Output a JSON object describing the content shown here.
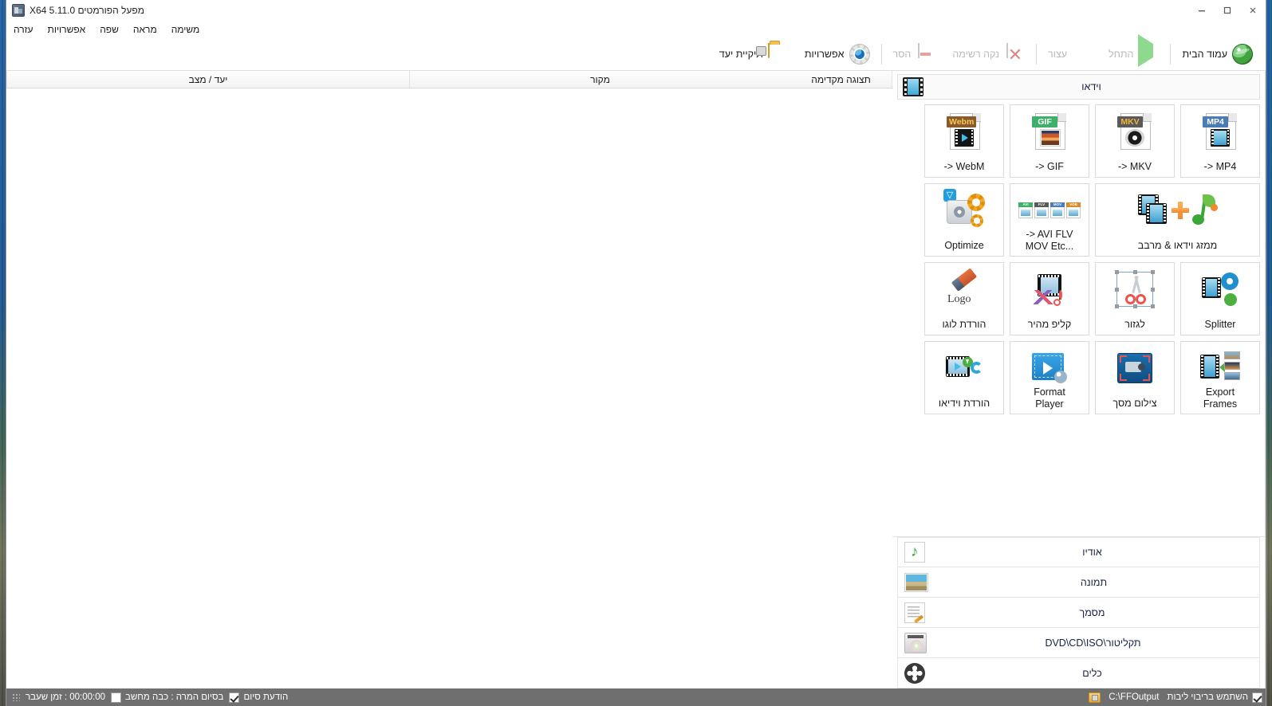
{
  "window": {
    "title": "מפעל הפורמטים X64 5.11.0",
    "app_icon": "app-icon",
    "minimize": "–",
    "maximize": "▢",
    "close": "✕"
  },
  "menu": {
    "items": [
      {
        "label": "משימה",
        "name": "menu-task"
      },
      {
        "label": "מראה",
        "name": "menu-appearance"
      },
      {
        "label": "שפה",
        "name": "menu-language"
      },
      {
        "label": "אפשרויות",
        "name": "menu-options"
      },
      {
        "label": "עזרה",
        "name": "menu-help"
      }
    ]
  },
  "toolbar": {
    "buttons": [
      {
        "label": "עמוד הבית",
        "icon": "globe-icon",
        "disabled": false
      },
      {
        "label": "התחל",
        "icon": "play-icon",
        "disabled": true
      },
      {
        "label": "עצור",
        "icon": "stop-icon",
        "disabled": true
      },
      {
        "label": "נקה רשימה",
        "icon": "clear-list-icon",
        "disabled": true
      },
      {
        "label": "הסר",
        "icon": "remove-icon",
        "disabled": true
      },
      {
        "label": "אפשרויות",
        "icon": "gear-icon",
        "disabled": false
      },
      {
        "label": "תיקיית יעד",
        "icon": "folder-icon",
        "disabled": false
      }
    ]
  },
  "left_panel": {
    "video_header": {
      "label": "וידאו",
      "icon": "film-icon"
    },
    "tiles": [
      {
        "label": "-> MP4",
        "badge": "MP4",
        "badge_color": "#4a7db5",
        "art": "film"
      },
      {
        "label": "-> MKV",
        "badge": "MKV",
        "badge_color": "#5a5a5a",
        "art": "disc"
      },
      {
        "label": "-> GIF",
        "badge": "GIF",
        "badge_color": "#3fb06a",
        "art": "photo"
      },
      {
        "label": "-> WebM",
        "badge": "Webm",
        "badge_color": "#8a5a2a",
        "art": "webm"
      },
      {
        "label": "ממזג וידאו & מרבב",
        "art": "merge",
        "wide": true,
        "rtl": true
      },
      {
        "label": "-> AVI FLV\nMOV Etc...",
        "art": "avi"
      },
      {
        "label": "Optimize",
        "art": "optimize"
      },
      {
        "label": "Splitter",
        "art": "splitter"
      },
      {
        "label": "לגזור",
        "art": "crop",
        "rtl": true
      },
      {
        "label": "קליפ מהיר",
        "art": "quickclip",
        "rtl": true
      },
      {
        "label": "הורדת לוגו",
        "art": "logo",
        "rtl": true
      },
      {
        "label": "Export\nFrames",
        "art": "frames"
      },
      {
        "label": "צילום מסך",
        "art": "screencap",
        "rtl": true
      },
      {
        "label": "Format\nPlayer",
        "art": "player"
      },
      {
        "label": "הורדת וידיאו",
        "art": "download",
        "rtl": true
      }
    ],
    "categories": [
      {
        "label": "אודיו",
        "icon": "audio-icon"
      },
      {
        "label": "תמונה",
        "icon": "image-icon"
      },
      {
        "label": "מסמך",
        "icon": "document-icon"
      },
      {
        "label": "תקליטור\\DVD\\CD\\ISO",
        "icon": "disc-icon"
      },
      {
        "label": "כלים",
        "icon": "tools-icon"
      }
    ]
  },
  "right_panel": {
    "columns": [
      {
        "label": "תצוגה מקדימה",
        "name": "column-preview"
      },
      {
        "label": "מקור",
        "name": "column-source"
      },
      {
        "label": "יעד / מצב",
        "name": "column-target-status"
      }
    ],
    "rows": []
  },
  "statusbar": {
    "output_path": "C:\\FFOutput",
    "multicore": {
      "label": "השתמש בריבוי ליבות",
      "checked": true
    },
    "finish_message": {
      "label": "הודעת סיום",
      "checked": true
    },
    "shutdown": {
      "label": "בסיום המרה : כבה מחשב",
      "checked": false
    },
    "elapsed": "00:00:00 : זמן שעבר"
  }
}
